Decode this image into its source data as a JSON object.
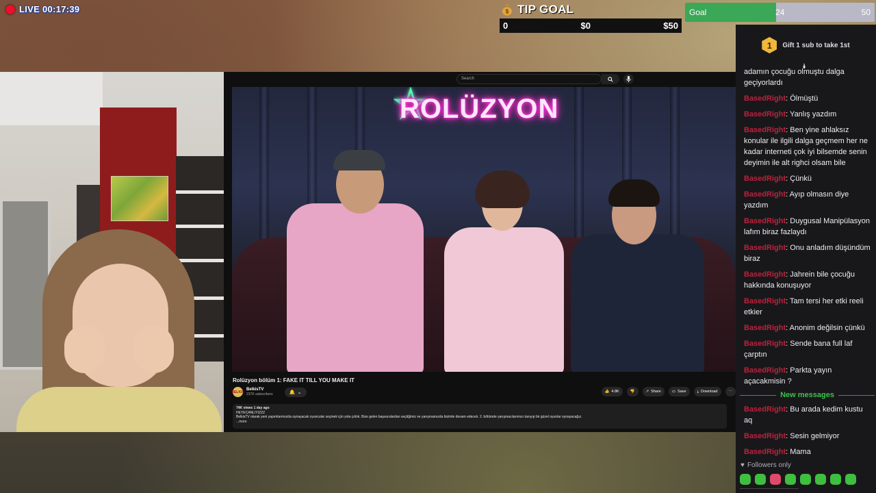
{
  "live": {
    "label": "LIVE 00:17:39"
  },
  "tip_goal": {
    "title": "TIP GOAL",
    "left": "0",
    "center": "$0",
    "right": "$50"
  },
  "goal": {
    "label": "Goal",
    "current": "24",
    "max": "50",
    "progress": 0.48
  },
  "youtube": {
    "search_placeholder": "Search",
    "neon_sign": "ROLÜZYON",
    "video_title": "Rolüzyon bölüm 1: FAKE IT TILL YOU MAKE IT",
    "channel_name": "BelkisTV",
    "subscribers": "237K subscribers",
    "channel_avatar_text": "BELKIS",
    "actions": {
      "likes": "4.8K",
      "share": "Share",
      "save": "Save",
      "download": "Download"
    },
    "description": {
      "meta": "74K views  1 day ago",
      "hashtag": "HEYECANLIYIZZZ",
      "text": "BelkisTV olarak yeni yapımlarımızda oynayacak oyuncular seçmek için yola çıktık. Bize gelen başvurulardan seçtiğimiz ve yarışmamızda bizimle devam edecek. 2. bölümde yarışmacılarımızı tanıyıp bir güzel oyunlar oynayacağız.",
      "more": "...more"
    }
  },
  "chat": {
    "pinned": {
      "badge": "1",
      "text": "Gift 1 sub to take 1st"
    },
    "truncated_message": "adamın çocuğu olmuştu dalga geçiyorlardı",
    "messages": [
      {
        "user": "BasedRight",
        "text": "Ölmüştü"
      },
      {
        "user": "BasedRight",
        "text": "Yanlış yazdım"
      },
      {
        "user": "BasedRight",
        "text": "Ben yine ahlaksız konular ile ilgili dalga geçmem her ne kadar interneti çok iyi bilsemde senin deyimin ile alt righci olsam bile"
      },
      {
        "user": "BasedRight",
        "text": "Çünkü"
      },
      {
        "user": "BasedRight",
        "text": "Ayıp olmasın diye yazdım"
      },
      {
        "user": "BasedRight",
        "text": "Duygusal Manipülasyon lafım biraz fazlaydı"
      },
      {
        "user": "BasedRight",
        "text": "Onu anladım düşündüm biraz"
      },
      {
        "user": "BasedRight",
        "text": "Jahrein bile çocuğu hakkında konuşuyor"
      },
      {
        "user": "BasedRight",
        "text": "Tam tersi her etki reeli etkier"
      },
      {
        "user": "BasedRight",
        "text": "Anonim değilsin çünkü"
      },
      {
        "user": "BasedRight",
        "text": "Sende bana full laf çarptın"
      },
      {
        "user": "BasedRight",
        "text": "Parkta yayın açacakmisin ?"
      }
    ],
    "new_messages_label": "New messages",
    "new_messages": [
      {
        "user": "BasedRight",
        "text": "Bu arada kedim kustu aq"
      },
      {
        "user": "BasedRight",
        "text": "Sesin gelmiyor"
      },
      {
        "user": "BasedRight",
        "text": "Mama"
      }
    ],
    "followers_only": "Followers only"
  },
  "colors": {
    "live_red": "#e8102a",
    "goal_green": "#3aa856",
    "chat_user": "#c0203a",
    "new_messages": "#3ec04e"
  }
}
